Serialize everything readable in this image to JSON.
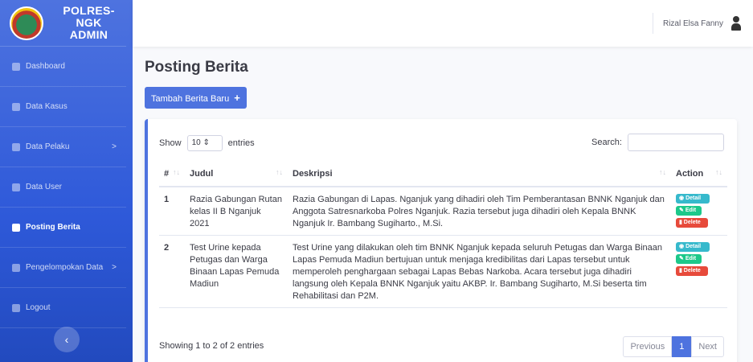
{
  "brand": {
    "line1": "POLRES-NGK",
    "line2": "ADMIN"
  },
  "sidebar": {
    "items": [
      {
        "label": "Dashboard",
        "icon": "tachometer-icon",
        "caret": ""
      },
      {
        "label": "Data Kasus",
        "icon": "file-icon",
        "caret": ""
      },
      {
        "label": "Data Pelaku",
        "icon": "users-icon",
        "caret": ">"
      },
      {
        "label": "Data User",
        "icon": "user-icon",
        "caret": ""
      },
      {
        "label": "Posting Berita",
        "icon": "newspaper-icon",
        "caret": ""
      },
      {
        "label": "Pengelompokan Data",
        "icon": "users-icon",
        "caret": ">"
      },
      {
        "label": "Logout",
        "icon": "sign-out-icon",
        "caret": ""
      }
    ],
    "toggle": "‹"
  },
  "topbar": {
    "user_name": "Rizal Elsa Fanny"
  },
  "page": {
    "title": "Posting Berita",
    "add_button": "Tambah Berita Baru",
    "add_icon": "+"
  },
  "table_controls": {
    "show": "Show",
    "entries_value": "10 ⇕",
    "entries": "entries",
    "search_label": "Search:"
  },
  "table": {
    "headers": [
      "#",
      "Judul",
      "Deskripsi",
      "Action"
    ],
    "rows": [
      {
        "no": "1",
        "judul": "Razia Gabungan Rutan kelas II B Nganjuk 2021",
        "deskripsi": "Razia Gabungan di Lapas. Nganjuk yang dihadiri oleh Tim Pemberantasan BNNK Nganjuk dan Anggota Satresnarkoba Polres Nganjuk. Razia tersebut juga dihadiri oleh Kepala BNNK Nganjuk Ir. Bambang Sugiharto., M.Si."
      },
      {
        "no": "2",
        "judul": "Test Urine kepada Petugas dan Warga Binaan Lapas Pemuda Madiun",
        "deskripsi": "Test Urine yang dilakukan oleh tim BNNK Nganjuk kepada seluruh Petugas dan Warga Binaan Lapas Pemuda Madiun bertujuan untuk menjaga kredibilitas dari Lapas tersebut untuk memperoleh penghargaan sebagai Lapas Bebas Narkoba. Acara tersebut juga dihadiri langsung oleh Kepala BNNK Nganjuk yaitu AKBP. Ir. Bambang Sugiharto, M.Si beserta tim Rehabilitasi dan P2M."
      }
    ],
    "actions": {
      "detail": "Detail",
      "edit": "Edit",
      "delete": "Delete"
    }
  },
  "footer": {
    "info": "Showing 1 to 2 of 2 entries",
    "prev": "Previous",
    "page": "1",
    "next": "Next"
  },
  "colors": {
    "primary": "#4e73df",
    "info": "#36b9cc",
    "success": "#1cc88a",
    "danger": "#e74a3b"
  }
}
